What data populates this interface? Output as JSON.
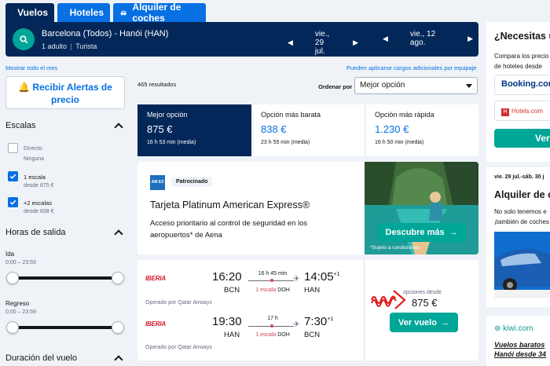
{
  "tabs": [
    {
      "label": "Vuelos",
      "icon": "plane-icon",
      "active": true
    },
    {
      "label": "Hoteles",
      "icon": "bed-icon",
      "active": false
    },
    {
      "label": "Alquiler de coches",
      "icon": "car-icon",
      "active": false
    }
  ],
  "search": {
    "route": "Barcelona (Todos) - Hanói (HAN)",
    "passengers": "1 adulto",
    "cabin": "Turista",
    "depart_date": "vie., 29 jul.",
    "return_date": "vie., 12 ago."
  },
  "links": {
    "show_month": "Mostrar todo el mes",
    "extra_fees": "Pueden aplicarse cargos adicionales por equipaje"
  },
  "sidebar": {
    "alert_button": "Recibir Alertas de precio",
    "stops_title": "Escalas",
    "stops": [
      {
        "label": "Directo",
        "sub": "Ninguna",
        "checked": false
      },
      {
        "label": "1 escala",
        "sub": "desde 875 €",
        "checked": true
      },
      {
        "label": "+2 escalas",
        "sub": "desde 838 €",
        "checked": true
      }
    ],
    "departure_title": "Horas de salida",
    "outbound_label": "Ida",
    "outbound_range": "0:00 – 23:59",
    "return_label": "Regreso",
    "return_range": "0:00 – 23:59",
    "duration_title": "Duración del vuelo"
  },
  "results": {
    "count": "465 resultados",
    "sort_label": "Ordenar por",
    "sort_value": "Mejor opción"
  },
  "sort_tabs": [
    {
      "title": "Mejor opción",
      "price": "875 €",
      "duration": "16 h 53 min (media)",
      "active": true
    },
    {
      "title": "Opción más barata",
      "price": "838 €",
      "duration": "23 h 55 min (media)",
      "active": false
    },
    {
      "title": "Opción más rápida",
      "price": "1.230 €",
      "duration": "16 h 50 min (media)",
      "active": false
    }
  ],
  "ad": {
    "logo_text": "AM EX",
    "badge": "Patrocinado",
    "title": "Tarjeta Platinum American Express®",
    "text": "Acceso prioritario al control de seguridad en los aeropuertos* de Aena",
    "button": "Descubre más",
    "note": "*Sujeto a condiciones"
  },
  "flight": {
    "airline": "IBERIA",
    "outbound": {
      "dep_time": "16:20",
      "dep_code": "BCN",
      "duration": "16 h 45 min",
      "stops": "1 escala",
      "stop_airport": "DOH",
      "arr_time": "14:05",
      "arr_plus": "+1",
      "arr_code": "HAN",
      "operator": "Operado por Qatar Airways"
    },
    "inbound": {
      "dep_time": "19:30",
      "dep_code": "HAN",
      "duration": "17 h",
      "stops": "1 escala",
      "stop_airport": "DOH",
      "arr_time": "7:30",
      "arr_plus": "+1",
      "arr_code": "BCN",
      "operator": "Operado por Qatar Airways"
    },
    "deals_label": "opciones desde",
    "price": "875 €",
    "button": "Ver vuelo"
  },
  "right": {
    "card1_title": "¿Necesitas u",
    "card1_text1": "Compara los precio",
    "card1_text2": "de hoteles desde",
    "provider1": "Booking.com",
    "provider2": "Hotels.com",
    "card1_button": "Ver",
    "card2_dates": "vie. 29 jul.-sáb. 30 j",
    "card2_title": "Alquiler de c",
    "card2_text1": "No solo tenemos e",
    "card2_text2": "¡también de coches",
    "card3_brand": "kiwi.com",
    "card3_text1": "Vuelos baratos",
    "card3_text2": "Hanói desde 34"
  },
  "colors": {
    "navy": "#042759",
    "blue": "#0770e3",
    "teal": "#00a698",
    "iberia_red": "#d7192d"
  }
}
